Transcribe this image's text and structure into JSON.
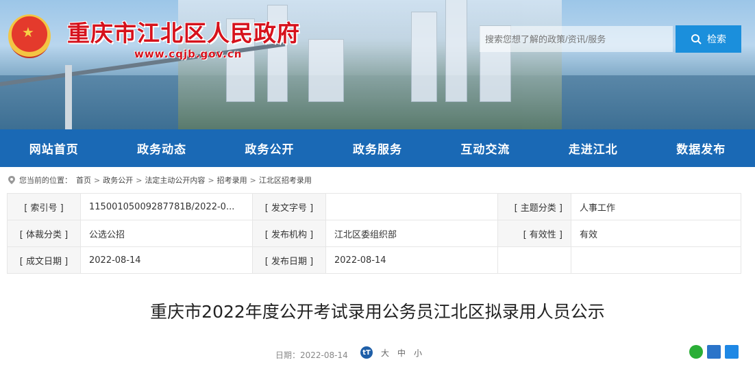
{
  "header": {
    "site_title": "重庆市江北区人民政府",
    "site_url": "www.cqjb.gov.cn",
    "search_placeholder": "搜索您想了解的政策/资讯/服务",
    "search_button": "检索"
  },
  "nav": {
    "items": [
      "网站首页",
      "政务动态",
      "政务公开",
      "政务服务",
      "互动交流",
      "走进江北",
      "数据发布"
    ]
  },
  "breadcrumb": {
    "prefix": "您当前的位置：",
    "items": [
      "首页",
      "政务公开",
      "法定主动公开内容",
      "招考录用",
      "江北区招考录用"
    ],
    "separator": ">"
  },
  "meta": {
    "rows": [
      [
        {
          "label": "[ 索引号 ]",
          "value": "11500105009287781B/2022-0..."
        },
        {
          "label": "[ 发文字号 ]",
          "value": ""
        },
        {
          "label": "[ 主题分类 ]",
          "value": "人事工作"
        }
      ],
      [
        {
          "label": "[ 体裁分类 ]",
          "value": "公选公招"
        },
        {
          "label": "[ 发布机构 ]",
          "value": "江北区委组织部"
        },
        {
          "label": "[ 有效性 ]",
          "value": "有效"
        }
      ],
      [
        {
          "label": "[ 成文日期 ]",
          "value": "2022-08-14"
        },
        {
          "label": "[ 发布日期 ]",
          "value": "2022-08-14"
        },
        {
          "label": "",
          "value": ""
        }
      ]
    ]
  },
  "article": {
    "title": "重庆市2022年度公开考试录用公务员江北区拟录用人员公示",
    "date": "日期：2022-08-14",
    "font_icon": "tT",
    "font_sizes": [
      "大",
      "中",
      "小"
    ]
  },
  "icons": {
    "search": "search-icon",
    "location": "location-icon",
    "wechat": "wechat-icon",
    "print": "print-icon",
    "copy": "copy-icon"
  },
  "colors": {
    "nav_bg": "#1a69b5",
    "title_red": "#d6121c",
    "search_btn": "#1b8fdc"
  }
}
